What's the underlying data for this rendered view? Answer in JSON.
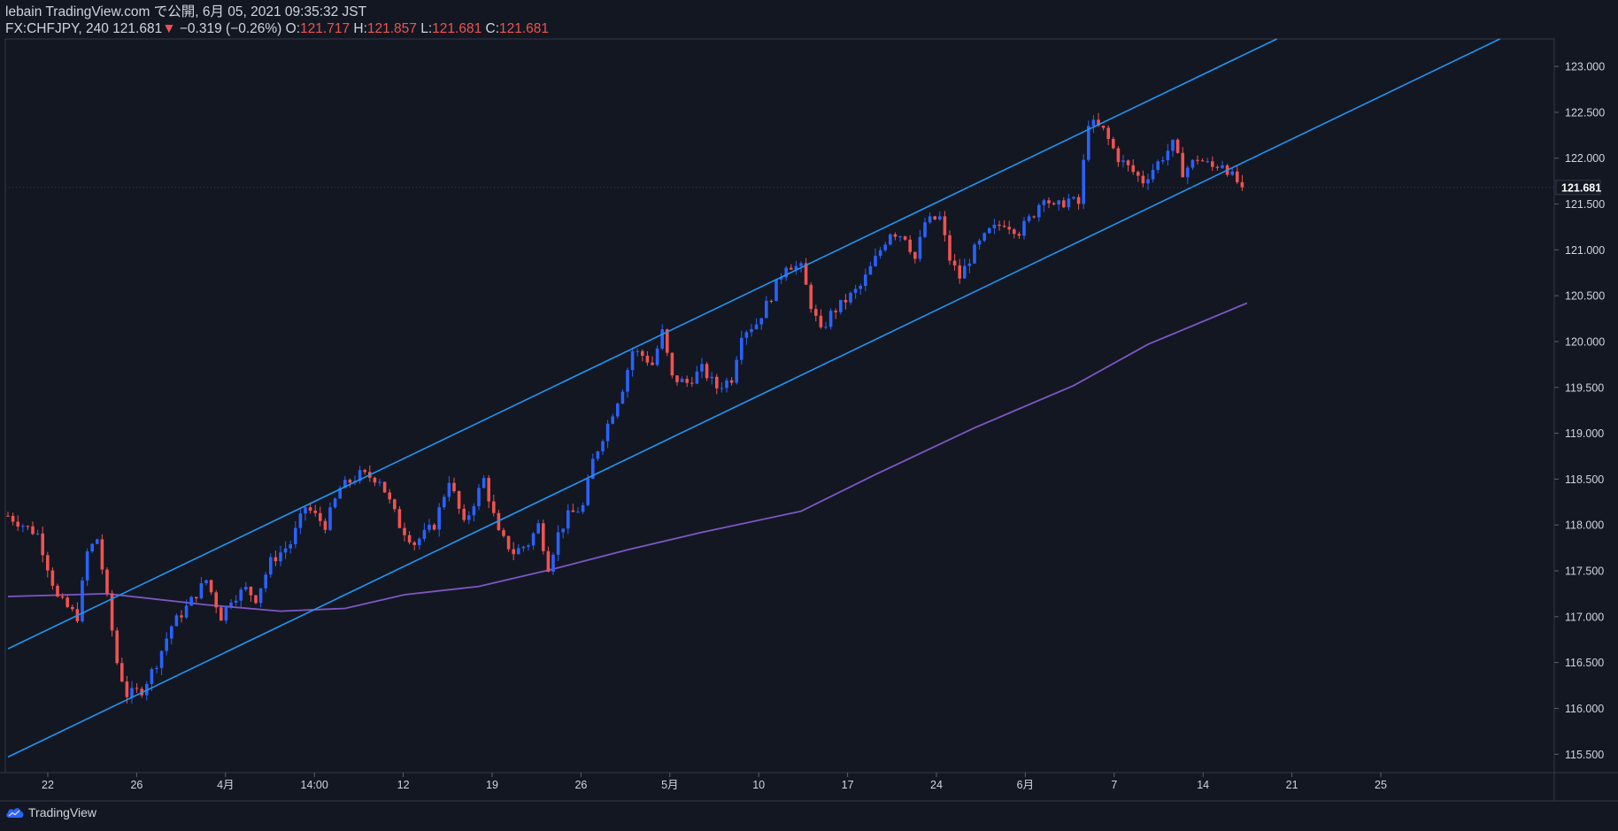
{
  "header": {
    "published_line": "lebain TradingView.com で公開, 6月 05, 2021 09:35:32 JST",
    "symbol": "FX:CHFJPY, 240",
    "last": "121.681",
    "change_arrow": "▼",
    "change": "−0.319 (−0.26%)",
    "o_label": "O:",
    "o_value": "121.717",
    "h_label": "H:",
    "h_value": "121.857",
    "l_label": "L:",
    "l_value": "121.681",
    "c_label": "C:",
    "c_value": "121.681"
  },
  "footer": {
    "brand": "TradingView",
    "icon": "tradingview-cloud-icon"
  },
  "colors": {
    "background": "#131722",
    "up": "#2962ff",
    "down": "#ef5350",
    "channel": "#2196f3",
    "ma": "#7e57c2",
    "grid": "#2a2e39",
    "text": "#d1d4dc",
    "price_tag_bg": "#131722"
  },
  "chart_data": {
    "type": "candlestick",
    "title": "",
    "symbol": "FX:CHFJPY",
    "interval": "240",
    "current_price": 121.681,
    "price_tag": "121.681",
    "ylim": [
      115.3,
      123.3
    ],
    "y_ticks": [
      "115.500",
      "116.000",
      "116.500",
      "117.000",
      "117.500",
      "118.000",
      "118.500",
      "119.000",
      "119.500",
      "120.000",
      "120.500",
      "121.000",
      "121.500",
      "122.000",
      "122.500",
      "123.000"
    ],
    "x_ticks": [
      "22",
      "26",
      "4月",
      "14:00",
      "12",
      "19",
      "26",
      "5月",
      "10",
      "17",
      "24",
      "6月",
      "7",
      "14",
      "21",
      "25"
    ],
    "price_path": [
      [
        0,
        118.1
      ],
      [
        6,
        117.9
      ],
      [
        10,
        117.2
      ],
      [
        14,
        117.0
      ],
      [
        16,
        117.7
      ],
      [
        18,
        117.85
      ],
      [
        20,
        117.2
      ],
      [
        22,
        116.5
      ],
      [
        24,
        116.15
      ],
      [
        27,
        116.2
      ],
      [
        30,
        116.5
      ],
      [
        33,
        116.9
      ],
      [
        36,
        117.1
      ],
      [
        40,
        117.4
      ],
      [
        43,
        117.0
      ],
      [
        45,
        117.2
      ],
      [
        48,
        117.3
      ],
      [
        50,
        117.2
      ],
      [
        53,
        117.6
      ],
      [
        57,
        117.8
      ],
      [
        60,
        118.2
      ],
      [
        64,
        118.0
      ],
      [
        67,
        118.4
      ],
      [
        71,
        118.55
      ],
      [
        75,
        118.5
      ],
      [
        79,
        118.0
      ],
      [
        82,
        117.8
      ],
      [
        86,
        118.0
      ],
      [
        89,
        118.5
      ],
      [
        92,
        118.0
      ],
      [
        96,
        118.5
      ],
      [
        99,
        117.9
      ],
      [
        102,
        117.7
      ],
      [
        105,
        117.8
      ],
      [
        107,
        118.0
      ],
      [
        109,
        117.55
      ],
      [
        111,
        117.9
      ],
      [
        113,
        118.1
      ],
      [
        116,
        118.2
      ],
      [
        118,
        118.7
      ],
      [
        121,
        119.1
      ],
      [
        124,
        119.5
      ],
      [
        126,
        119.9
      ],
      [
        128,
        119.85
      ],
      [
        130,
        119.75
      ],
      [
        132,
        120.1
      ],
      [
        134,
        119.6
      ],
      [
        137,
        119.55
      ],
      [
        140,
        119.7
      ],
      [
        143,
        119.5
      ],
      [
        146,
        119.6
      ],
      [
        148,
        120.1
      ],
      [
        151,
        120.2
      ],
      [
        154,
        120.5
      ],
      [
        157,
        120.85
      ],
      [
        160,
        120.8
      ],
      [
        162,
        120.4
      ],
      [
        164,
        120.1
      ],
      [
        166,
        120.3
      ],
      [
        169,
        120.45
      ],
      [
        172,
        120.6
      ],
      [
        175,
        120.9
      ],
      [
        178,
        121.2
      ],
      [
        181,
        121.15
      ],
      [
        183,
        120.9
      ],
      [
        185,
        121.3
      ],
      [
        188,
        121.35
      ],
      [
        190,
        120.9
      ],
      [
        192,
        120.7
      ],
      [
        195,
        121.0
      ],
      [
        198,
        121.2
      ],
      [
        201,
        121.3
      ],
      [
        204,
        121.2
      ],
      [
        207,
        121.4
      ],
      [
        209,
        121.6
      ],
      [
        211,
        121.45
      ],
      [
        214,
        121.55
      ],
      [
        216,
        121.5
      ],
      [
        218,
        122.4
      ],
      [
        221,
        122.3
      ],
      [
        224,
        122.0
      ],
      [
        227,
        121.85
      ],
      [
        229,
        121.75
      ],
      [
        232,
        121.95
      ],
      [
        235,
        122.15
      ],
      [
        237,
        121.85
      ],
      [
        240,
        122.0
      ],
      [
        243,
        121.9
      ],
      [
        245,
        121.95
      ],
      [
        247,
        121.8
      ],
      [
        249,
        121.681
      ]
    ],
    "ma_series": [
      [
        0,
        117.22
      ],
      [
        20,
        117.25
      ],
      [
        40,
        117.13
      ],
      [
        55,
        117.06
      ],
      [
        68,
        117.09
      ],
      [
        80,
        117.24
      ],
      [
        95,
        117.33
      ],
      [
        110,
        117.52
      ],
      [
        125,
        117.73
      ],
      [
        140,
        117.92
      ],
      [
        160,
        118.15
      ],
      [
        175,
        118.55
      ],
      [
        195,
        119.06
      ],
      [
        215,
        119.52
      ],
      [
        230,
        119.97
      ],
      [
        250,
        120.42
      ]
    ],
    "channel_lines": [
      {
        "name": "upper",
        "from": [
          0,
          116.65
        ],
        "to": [
          256,
          123.3
        ]
      },
      {
        "name": "lower",
        "from": [
          0,
          115.47
        ],
        "to": [
          301,
          123.3
        ]
      }
    ]
  }
}
